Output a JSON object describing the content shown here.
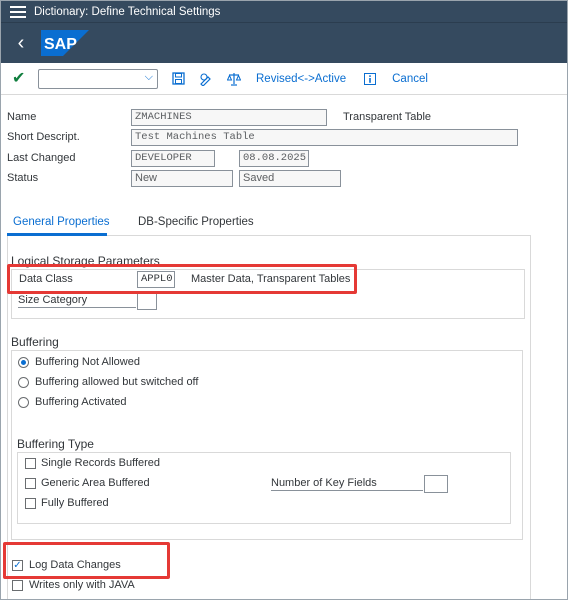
{
  "window": {
    "title": "Dictionary: Define Technical Settings"
  },
  "shell": {
    "logo_text": "SAP",
    "brand_color": "#0a6ed1",
    "header_color": "#354a5f"
  },
  "toolbar": {
    "command_field_value": "",
    "revised_active_label": "Revised<->Active",
    "cancel_label": "Cancel",
    "icons": [
      "checkmark-icon",
      "save-icon",
      "display-change-icon",
      "compare-icon",
      "info-icon"
    ]
  },
  "header": {
    "name_label": "Name",
    "name_value": "ZMACHINES",
    "table_type": "Transparent Table",
    "short_desc_label": "Short Descript.",
    "short_desc_value": "Test Machines Table",
    "last_changed_label": "Last Changed",
    "last_changed_user": "DEVELOPER",
    "last_changed_date": "08.08.2025",
    "status_label": "Status",
    "status_value_1": "New",
    "status_value_2": "Saved"
  },
  "tabs": [
    {
      "label": "General Properties",
      "active": true
    },
    {
      "label": "DB-Specific Properties",
      "active": false
    }
  ],
  "logical_storage": {
    "title": "Logical Storage Parameters",
    "data_class_label": "Data Class",
    "data_class_value": "APPL0",
    "data_class_desc": "Master Data, Transparent Tables",
    "size_category_label": "Size Category",
    "size_category_value": ""
  },
  "buffering": {
    "title": "Buffering",
    "options": [
      {
        "label": "Buffering Not Allowed",
        "selected": true
      },
      {
        "label": "Buffering allowed but switched off",
        "selected": false
      },
      {
        "label": "Buffering Activated",
        "selected": false
      }
    ]
  },
  "buffering_type": {
    "title": "Buffering Type",
    "options": [
      {
        "label": "Single Records Buffered",
        "checked": false
      },
      {
        "label": "Generic Area Buffered",
        "checked": false
      },
      {
        "label": "Fully Buffered",
        "checked": false
      }
    ],
    "key_fields_label": "Number of Key Fields",
    "key_fields_value": ""
  },
  "log_data_changes": {
    "label": "Log Data Changes",
    "checked": true
  },
  "writes_only_java": {
    "label": "Writes only with JAVA",
    "checked": false
  },
  "colors": {
    "highlight": "#e53935",
    "accent": "#0a6ed1",
    "ok_green": "#107e3e"
  }
}
